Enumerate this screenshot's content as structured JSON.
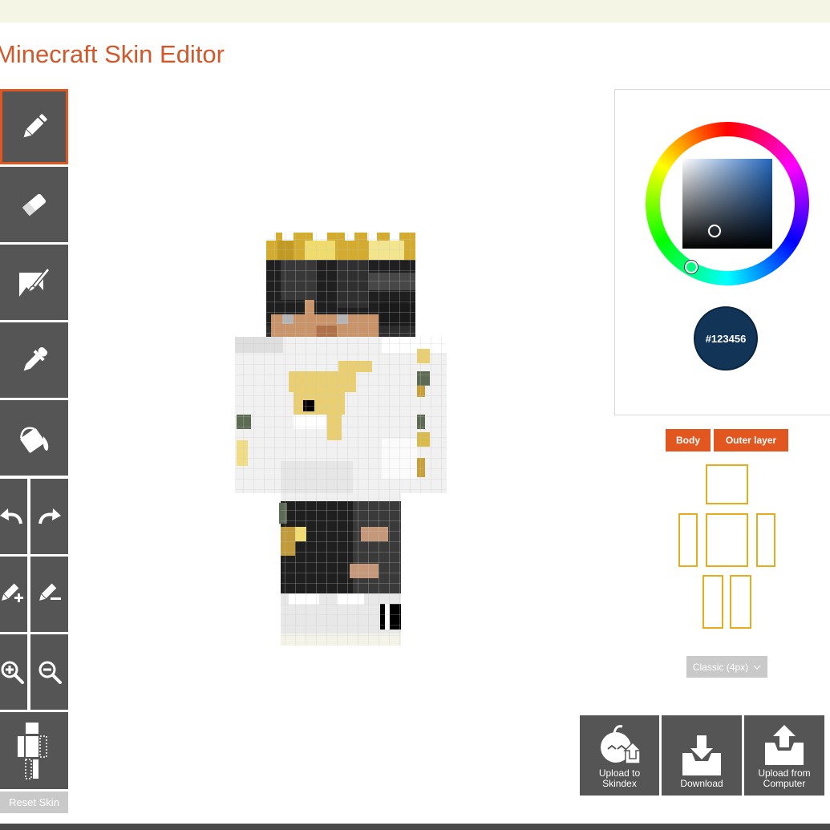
{
  "page": {
    "title": "Minecraft Skin Editor"
  },
  "toolbar": {
    "tools": [
      "pencil",
      "eraser",
      "brush",
      "eyedropper",
      "bucket",
      "undo",
      "redo",
      "darken",
      "lighten",
      "zoom-in",
      "zoom-out",
      "toggle-parts"
    ],
    "active_tool": "pencil",
    "reset_label": "Reset Skin"
  },
  "color_picker": {
    "hex": "#123456",
    "current_color": "#123456"
  },
  "layers": {
    "body_label": "Body",
    "outer_label": "Outer layer"
  },
  "model": {
    "selected": "Classic (4px)"
  },
  "actions": {
    "upload_skindex": "Upload to\nSkindex",
    "download": "Download",
    "upload_computer": "Upload from\nComputer"
  },
  "colors": {
    "accent": "#e2571f",
    "tool_bg": "#555555",
    "title": "#d2572a",
    "part_outline": "#e4ad1b"
  },
  "icons": {
    "pencil": "pencil-icon",
    "eraser": "eraser-icon",
    "brush": "paint-brush-icon",
    "eyedropper": "eyedropper-icon",
    "bucket": "paint-bucket-icon",
    "undo": "undo-icon",
    "redo": "redo-icon",
    "darken": "darken-icon",
    "lighten": "lighten-icon",
    "zoom_in": "zoom-in-icon",
    "zoom_out": "zoom-out-icon",
    "parts": "body-parts-icon"
  }
}
